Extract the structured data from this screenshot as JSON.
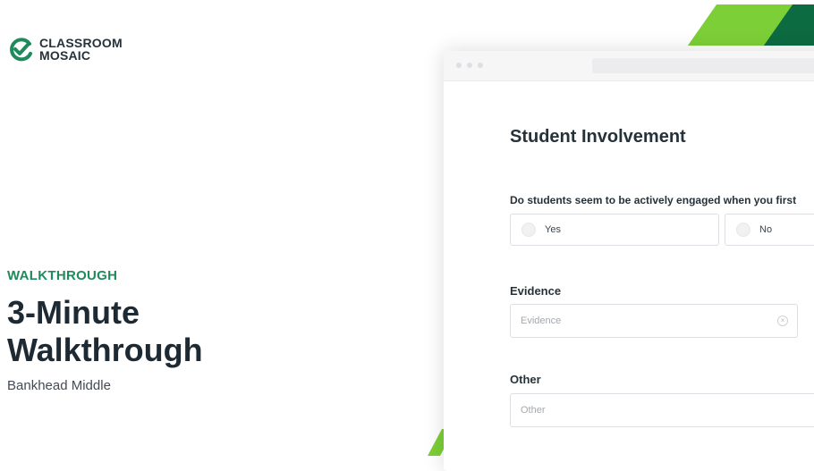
{
  "brand": {
    "logo_line1": "CLASSROOM",
    "logo_line2": "MOSAIC",
    "logo_icon": "check-circle-icon",
    "color_primary": "#1f8a5c",
    "color_accent_light": "#7ccf36",
    "color_accent_dark": "#0c6b41"
  },
  "hero": {
    "eyebrow": "WALKTHROUGH",
    "title": "3-Minute Walkthrough",
    "subtitle": "Bankhead Middle"
  },
  "form": {
    "section_title": "Student Involvement",
    "question": "Do students seem to be actively engaged when you first",
    "options": [
      {
        "label": "Yes"
      },
      {
        "label": "No"
      }
    ],
    "evidence": {
      "label": "Evidence",
      "placeholder": "Evidence"
    },
    "other": {
      "label": "Other",
      "placeholder": "Other"
    }
  }
}
